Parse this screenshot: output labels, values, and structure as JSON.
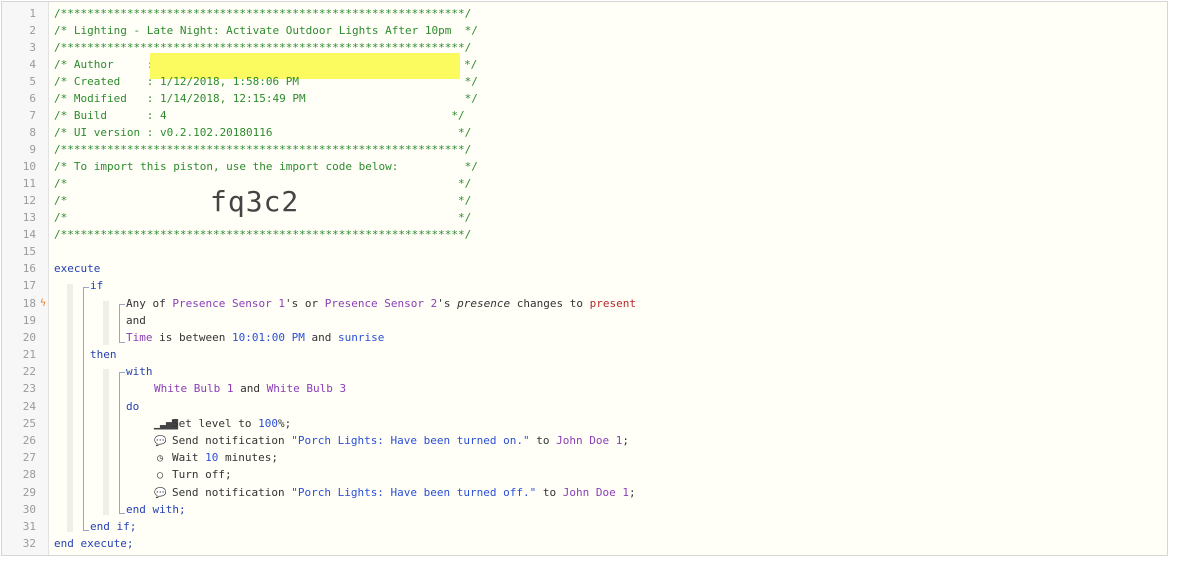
{
  "header": {
    "border_line": "/*************************************************************/",
    "title_line": "/* Lighting - Late Night: Activate Outdoor Lights After 10pm  */",
    "author_line": "/* Author     : ",
    "author_end": "*/",
    "created_line": "/* Created    : 1/12/2018, 1:58:06 PM                         */",
    "modified_line": "/* Modified   : 1/14/2018, 12:15:49 PM                        */",
    "build_line": "/* Build      : 4                                           */",
    "ui_version_line": "/* UI version : v0.2.102.20180116                            */",
    "import_hint_line": "/* To import this piston, use the import code below:          */",
    "empty_comment_line": "/*                                                           */",
    "import_code": "fq3c2"
  },
  "line_numbers": [
    "1",
    "2",
    "3",
    "4",
    "5",
    "6",
    "7",
    "8",
    "9",
    "10",
    "11",
    "12",
    "13",
    "14",
    "15",
    "16",
    "17",
    "18",
    "19",
    "20",
    "21",
    "22",
    "23",
    "24",
    "25",
    "26",
    "27",
    "28",
    "29",
    "30",
    "31",
    "32"
  ],
  "code": {
    "execute": "execute",
    "if": "if",
    "cond1": {
      "any_of": "Any of ",
      "sensor1": "Presence Sensor 1",
      "sep1": "'s or ",
      "sensor2": "Presence Sensor 2",
      "sep2": "'s ",
      "attribute": "presence",
      "changes_to": " changes to ",
      "value": "present"
    },
    "and": "and",
    "cond2": {
      "time": "Time",
      "is_between": " is between ",
      "start": "10:01:00 PM",
      "and": " and ",
      "end": "sunrise"
    },
    "then": "then",
    "with": "with",
    "devices": {
      "bulb1": "White Bulb 1",
      "and": " and ",
      "bulb2": "White Bulb 3"
    },
    "do": "do",
    "actions": {
      "set_level": "Set level to ",
      "level_value": "100",
      "level_end": "%;",
      "notify1_cmd": "Send notification ",
      "notify1_msg": "\"Porch Lights: Have been turned on.\"",
      "to1": " to ",
      "recipient1": "John Doe 1",
      "semi1": ";",
      "wait": "Wait ",
      "wait_value": "10",
      "wait_end": " minutes;",
      "turn_off": "Turn off;",
      "notify2_cmd": "Send notification ",
      "notify2_msg": "\"Porch Lights: Have been turned off.\"",
      "to2": " to ",
      "recipient2": "John Doe 1",
      "semi2": ";"
    },
    "end_with": "end with;",
    "end_if": "end if;",
    "end_execute": "end execute;"
  },
  "icons": {
    "signal": "signal-icon",
    "message": "message-icon",
    "clock": "clock-icon",
    "power": "power-icon",
    "bolt": "bolt-icon"
  },
  "colors": {
    "comment": "#2e8b2e",
    "keyword": "#2541b2",
    "device": "#8a3fb6",
    "value": "#2b4fd6",
    "state": "#b52a2a",
    "redaction": "#fbfb60"
  }
}
